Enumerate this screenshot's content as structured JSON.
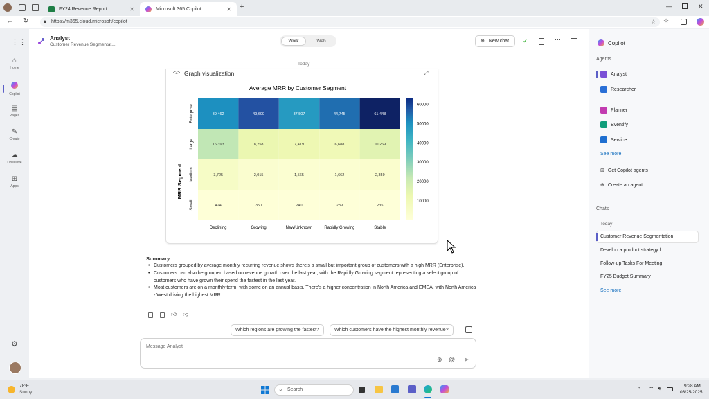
{
  "browser": {
    "tabs": [
      {
        "label": "FY24 Revenue Report",
        "favicon_color": "#1e7e45"
      },
      {
        "label": "Microsoft 365 Copilot",
        "favicon_color": "#c050d8"
      }
    ],
    "url": "https://m365.cloud.microsoft/copilot"
  },
  "rail": {
    "items": [
      {
        "label": "Home",
        "icon": "home-icon"
      },
      {
        "label": "Copilot",
        "icon": "copilot-icon"
      },
      {
        "label": "Pages",
        "icon": "pages-icon"
      },
      {
        "label": "Create",
        "icon": "create-icon"
      },
      {
        "label": "OneDrive",
        "icon": "onedrive-icon"
      },
      {
        "label": "Apps",
        "icon": "apps-icon"
      }
    ]
  },
  "header": {
    "agent_name": "Analyst",
    "conversation": "Customer Revenue Segmentat...",
    "toggle": {
      "work": "Work",
      "web": "Web"
    },
    "new_chat": "New chat"
  },
  "conversation": {
    "date_label": "Today",
    "card_title": "Graph visualization",
    "summary_heading": "Summary:",
    "summary": [
      "Customers grouped by average monthly recurring revenue shows there's a small but important group of customers with a high MRR (Enterprise).",
      "Customers can also be grouped based on revenue growth over the last year, with the Rapidly Growing segment representing a select group of customers who have grown their spend the fastest in the last year.",
      "Most customers are on a monthly term, with some on an annual basis. There's a higher concentration in North America and EMEA, with North America - West driving the highest MRR."
    ],
    "suggestions": [
      "Which regions are growing the fastest?",
      "Which customers have the highest monthly revenue?"
    ],
    "input_placeholder": "Message Analyst"
  },
  "chart_data": {
    "type": "heatmap",
    "title": "Average MRR by Customer Segment",
    "ylabel": "MRR Segment",
    "xlabel": "",
    "x_categories": [
      "Declining",
      "Growing",
      "New/Unknown",
      "Rapidly Growing",
      "Stable"
    ],
    "y_categories": [
      "Enterprise",
      "Large",
      "Medium",
      "Small"
    ],
    "values": [
      [
        39462,
        49600,
        37507,
        44745,
        61448
      ],
      [
        16393,
        8258,
        7419,
        6688,
        10269
      ],
      [
        3725,
        2015,
        1565,
        1662,
        2359
      ],
      [
        424,
        350,
        240,
        289,
        235
      ]
    ],
    "value_labels": [
      [
        "39,462",
        "49,600",
        "37,507",
        "44,745",
        "61,448"
      ],
      [
        "16,393",
        "8,258",
        "7,419",
        "6,688",
        "10,269"
      ],
      [
        "3,725",
        "2,015",
        "1,565",
        "1,662",
        "2,359"
      ],
      [
        "424",
        "350",
        "240",
        "289",
        "235"
      ]
    ],
    "colorbar_ticks": [
      "60000",
      "50000",
      "40000",
      "30000",
      "20000",
      "10000"
    ],
    "colorbar_tick_values": [
      60000,
      50000,
      40000,
      30000,
      20000,
      10000
    ],
    "vmin": 0,
    "vmax": 63000,
    "colormap": "YlGnBu"
  },
  "sidebar": {
    "title": "Copilot",
    "agents_heading": "Agents",
    "agents": [
      {
        "label": "Analyst",
        "color": "#7a4fd6"
      },
      {
        "label": "Researcher",
        "color": "#2a6fd6"
      },
      {
        "label": "Planner",
        "color": "#c23bb0"
      },
      {
        "label": "Eventify",
        "color": "#0f9d7a"
      },
      {
        "label": "Service",
        "color": "#1f6fd0"
      }
    ],
    "see_more": "See more",
    "get_agents": "Get Copilot agents",
    "create_agent": "Create an agent",
    "chats_heading": "Chats",
    "chats_today": "Today",
    "chats": [
      "Customer Revenue Segmentation",
      "Develop a product strategy f...",
      "Follow-up Tasks For Meeting",
      "FY25 Budget Summary"
    ],
    "see_more_chats": "See more"
  },
  "taskbar": {
    "weather_temp": "78°F",
    "weather_desc": "Sunny",
    "search_placeholder": "Search",
    "time": "9:28 AM",
    "date": "03/25/2025"
  }
}
